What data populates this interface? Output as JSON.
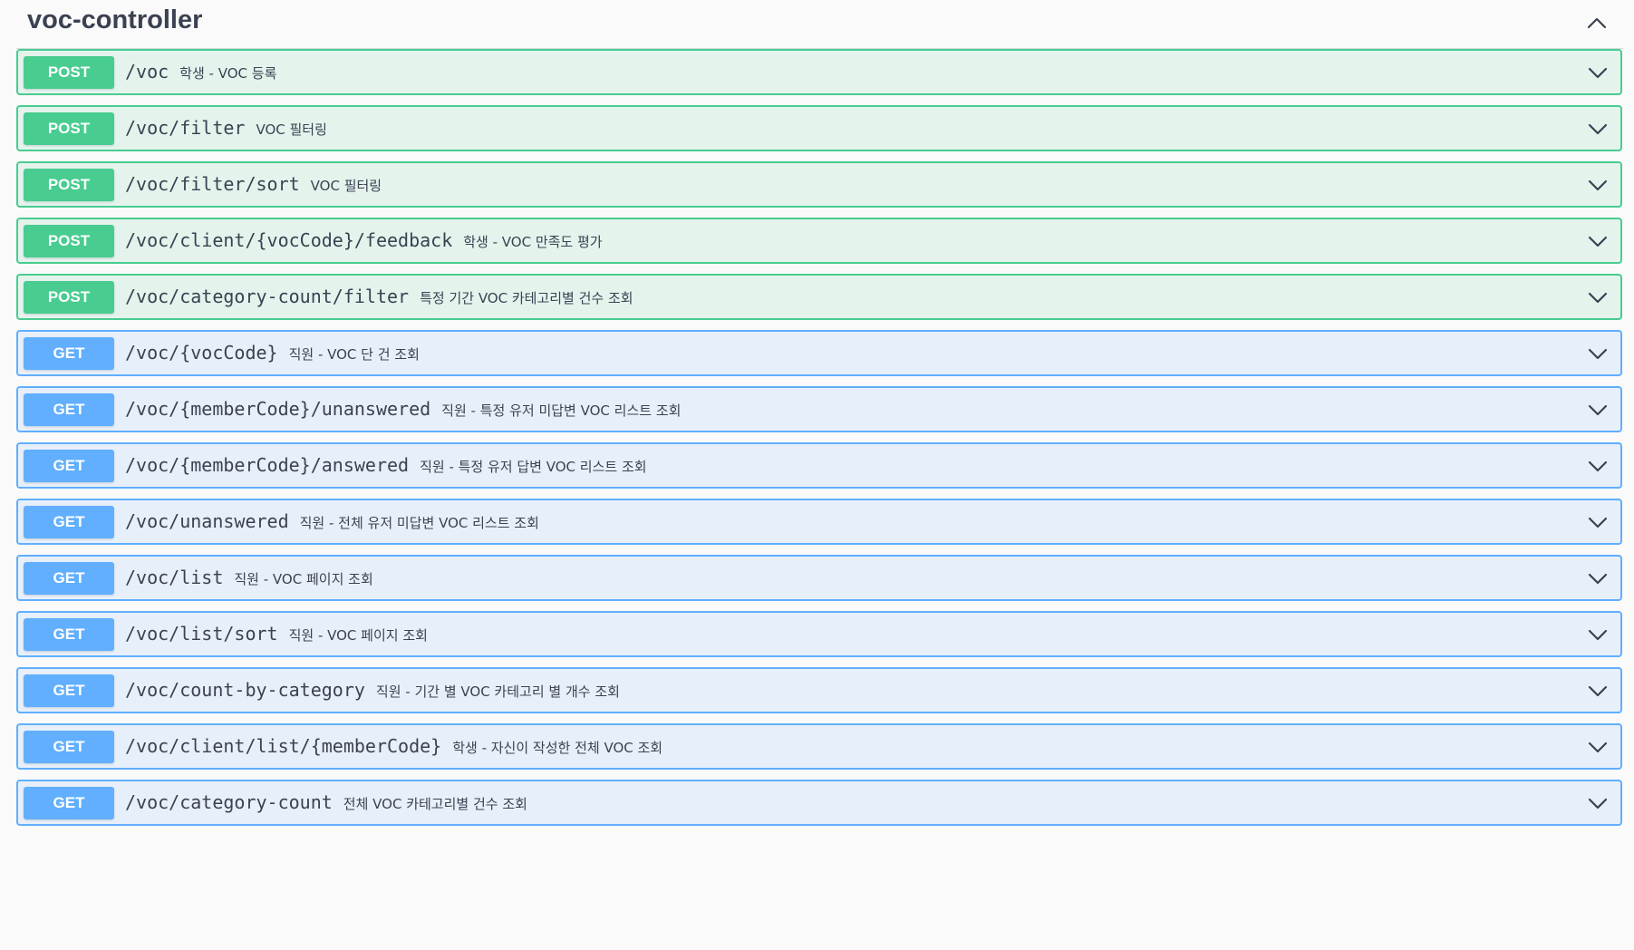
{
  "section": {
    "title": "voc-controller",
    "collapse_icon": "chevron-up-icon"
  },
  "operations": [
    {
      "method": "POST",
      "path": "/voc",
      "summary": "학생 - VOC 등록"
    },
    {
      "method": "POST",
      "path": "/voc/filter",
      "summary": "VOC 필터링"
    },
    {
      "method": "POST",
      "path": "/voc/filter/sort",
      "summary": "VOC 필터링"
    },
    {
      "method": "POST",
      "path": "/voc/client/{vocCode}/feedback",
      "summary": "학생 - VOC 만족도 평가"
    },
    {
      "method": "POST",
      "path": "/voc/category-count/filter",
      "summary": "특정 기간 VOC 카테고리별 건수 조회"
    },
    {
      "method": "GET",
      "path": "/voc/{vocCode}",
      "summary": "직원 - VOC 단 건 조회"
    },
    {
      "method": "GET",
      "path": "/voc/{memberCode}/unanswered",
      "summary": "직원 - 특정 유저 미답변 VOC 리스트 조회"
    },
    {
      "method": "GET",
      "path": "/voc/{memberCode}/answered",
      "summary": "직원 - 특정 유저 답변 VOC 리스트 조회"
    },
    {
      "method": "GET",
      "path": "/voc/unanswered",
      "summary": "직원 - 전체 유저 미답변 VOC 리스트 조회"
    },
    {
      "method": "GET",
      "path": "/voc/list",
      "summary": "직원 - VOC 페이지 조회"
    },
    {
      "method": "GET",
      "path": "/voc/list/sort",
      "summary": "직원 - VOC 페이지 조회"
    },
    {
      "method": "GET",
      "path": "/voc/count-by-category",
      "summary": "직원 - 기간 별 VOC 카테고리 별 개수 조회"
    },
    {
      "method": "GET",
      "path": "/voc/client/list/{memberCode}",
      "summary": "학생 - 자신이 작성한 전체 VOC 조회"
    },
    {
      "method": "GET",
      "path": "/voc/category-count",
      "summary": "전체 VOC 카테고리별 건수 조회"
    }
  ],
  "colors": {
    "post": "#49cc90",
    "get": "#61affe",
    "text": "#3b4151"
  },
  "icons": {
    "expand": "chevron-down-icon"
  }
}
